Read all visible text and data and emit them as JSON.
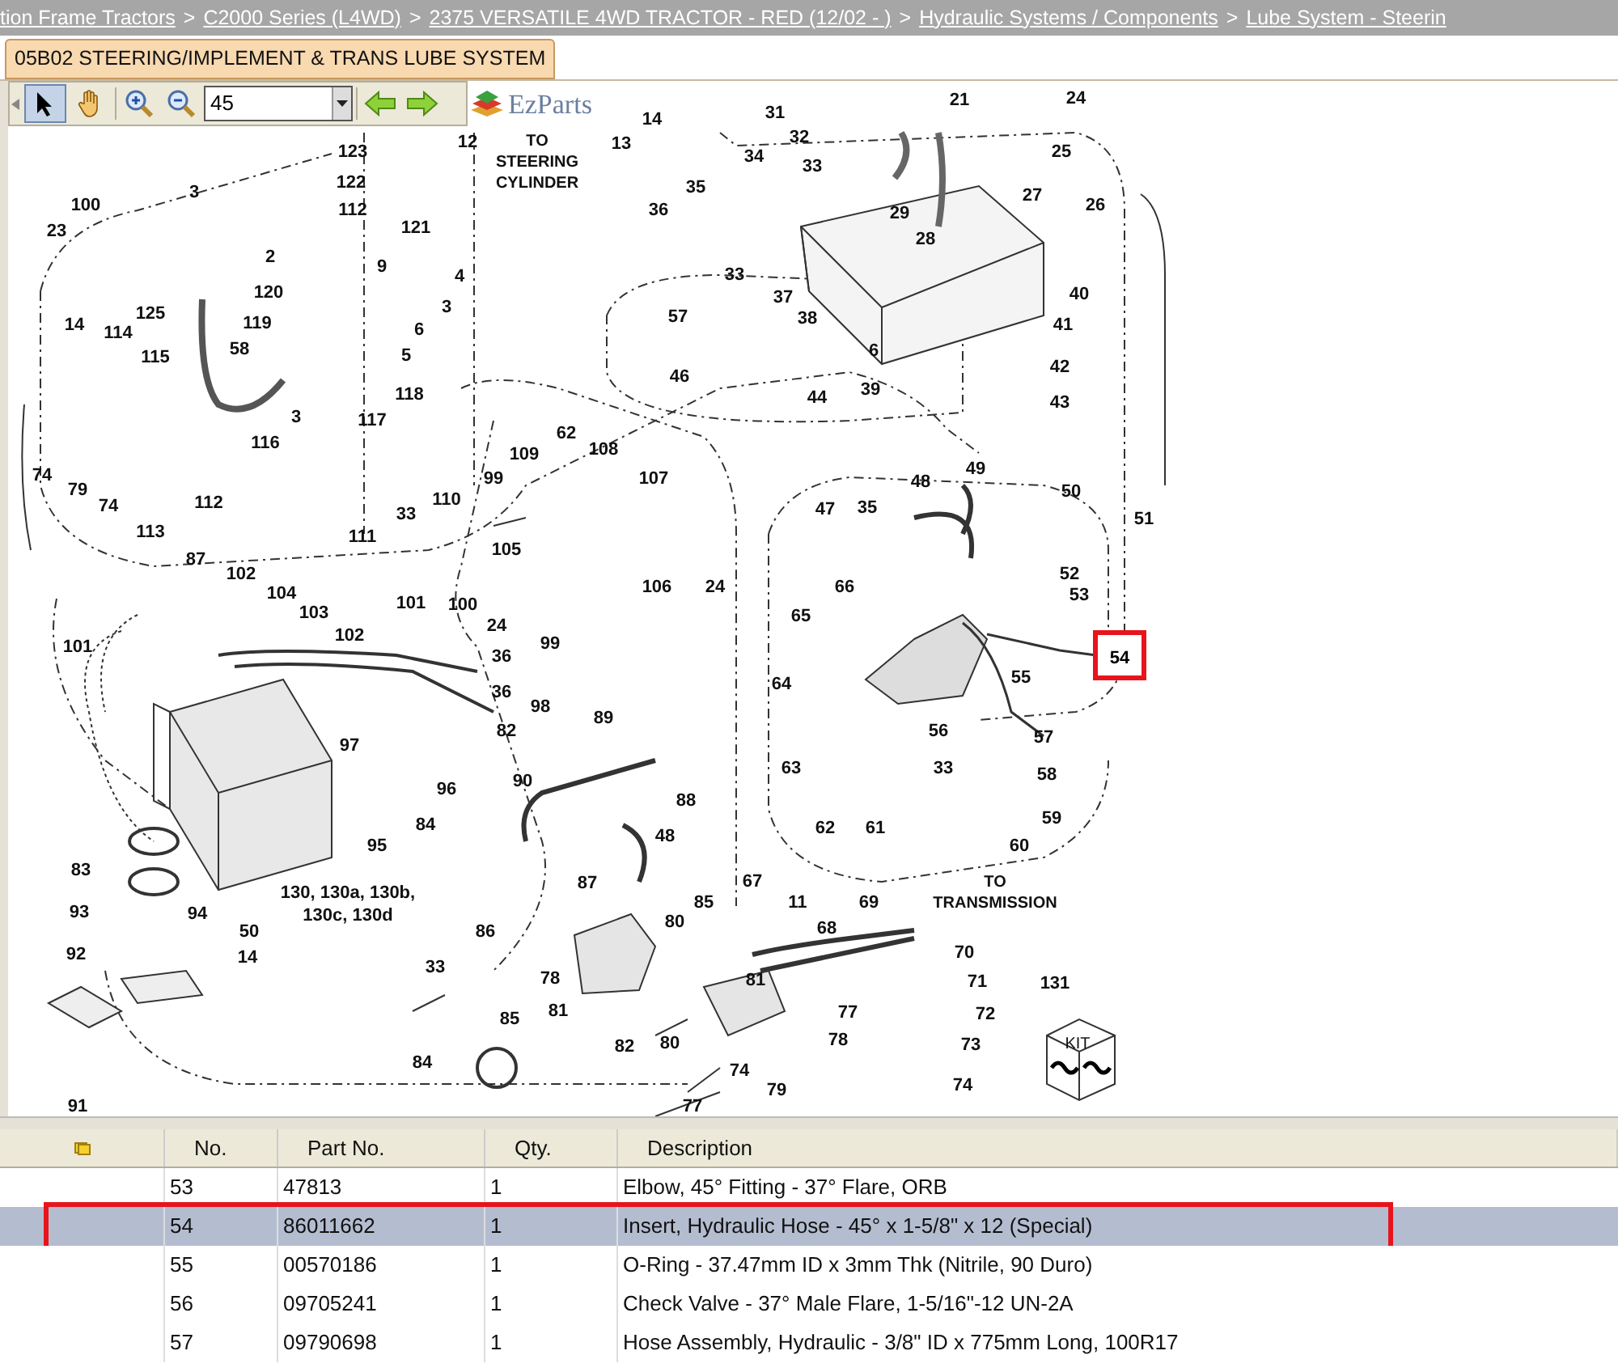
{
  "breadcrumb": [
    {
      "kind": "link",
      "text": "tion Frame Tractors"
    },
    {
      "kind": "separator",
      "text": ">"
    },
    {
      "kind": "link",
      "text": "C2000 Series (L4WD)"
    },
    {
      "kind": "separator",
      "text": ">"
    },
    {
      "kind": "link",
      "text": "2375 VERSATILE 4WD TRACTOR - RED (12/02 - )"
    },
    {
      "kind": "separator",
      "text": ">"
    },
    {
      "kind": "link",
      "text": "Hydraulic Systems / Components"
    },
    {
      "kind": "separator",
      "text": ">"
    },
    {
      "kind": "link",
      "text": "Lube System - Steerin"
    }
  ],
  "tabs": [
    {
      "label": "05B02 STEERING/IMPLEMENT & TRANS LUBE SYSTEM",
      "selected": true
    }
  ],
  "toolbar": {
    "tools": [
      {
        "kind": "pointer",
        "selected": true
      },
      {
        "kind": "hand",
        "selected": false
      }
    ],
    "zoom_value": "45",
    "logo": "EzParts"
  },
  "diagram": {
    "notes": [
      "TO STEERING CYLINDER",
      "TO TRANSMISSION"
    ],
    "kit_label": "KIT",
    "callouts": [
      {
        "label": "21",
        "selected": false
      },
      {
        "label": "24",
        "selected": false
      },
      {
        "label": "31",
        "selected": false
      },
      {
        "label": "14",
        "selected": false
      },
      {
        "label": "12",
        "selected": false
      },
      {
        "label": "13",
        "selected": false
      },
      {
        "label": "32",
        "selected": false
      },
      {
        "label": "123",
        "selected": false
      },
      {
        "label": "34",
        "selected": false
      },
      {
        "label": "25",
        "selected": false
      },
      {
        "label": "33",
        "selected": false
      },
      {
        "label": "3",
        "selected": false
      },
      {
        "label": "122",
        "selected": false
      },
      {
        "label": "35",
        "selected": false
      },
      {
        "label": "27",
        "selected": false
      },
      {
        "label": "100",
        "selected": false
      },
      {
        "label": "112",
        "selected": false
      },
      {
        "label": "36",
        "selected": false
      },
      {
        "label": "29",
        "selected": false
      },
      {
        "label": "26",
        "selected": false
      },
      {
        "label": "23",
        "selected": false
      },
      {
        "label": "121",
        "selected": false
      },
      {
        "label": "28",
        "selected": false
      },
      {
        "label": "2",
        "selected": false
      },
      {
        "label": "9",
        "selected": false
      },
      {
        "label": "4",
        "selected": false
      },
      {
        "label": "33",
        "selected": false
      },
      {
        "label": "120",
        "selected": false
      },
      {
        "label": "37",
        "selected": false
      },
      {
        "label": "40",
        "selected": false
      },
      {
        "label": "14",
        "selected": false
      },
      {
        "label": "114",
        "selected": false
      },
      {
        "label": "125",
        "selected": false
      },
      {
        "label": "119",
        "selected": false
      },
      {
        "label": "6",
        "selected": false
      },
      {
        "label": "3",
        "selected": false
      },
      {
        "label": "57",
        "selected": false
      },
      {
        "label": "38",
        "selected": false
      },
      {
        "label": "41",
        "selected": false
      },
      {
        "label": "115",
        "selected": false
      },
      {
        "label": "58",
        "selected": false
      },
      {
        "label": "5",
        "selected": false
      },
      {
        "label": "6",
        "selected": false
      },
      {
        "label": "42",
        "selected": false
      },
      {
        "label": "46",
        "selected": false
      },
      {
        "label": "118",
        "selected": false
      },
      {
        "label": "44",
        "selected": false
      },
      {
        "label": "39",
        "selected": false
      },
      {
        "label": "43",
        "selected": false
      },
      {
        "label": "3",
        "selected": false
      },
      {
        "label": "117",
        "selected": false
      },
      {
        "label": "62",
        "selected": false
      },
      {
        "label": "116",
        "selected": false
      },
      {
        "label": "109",
        "selected": false
      },
      {
        "label": "108",
        "selected": false
      },
      {
        "label": "74",
        "selected": false
      },
      {
        "label": "79",
        "selected": false
      },
      {
        "label": "99",
        "selected": false
      },
      {
        "label": "107",
        "selected": false
      },
      {
        "label": "48",
        "selected": false
      },
      {
        "label": "49",
        "selected": false
      },
      {
        "label": "50",
        "selected": false
      },
      {
        "label": "74",
        "selected": false
      },
      {
        "label": "112",
        "selected": false
      },
      {
        "label": "33",
        "selected": false
      },
      {
        "label": "110",
        "selected": false
      },
      {
        "label": "47",
        "selected": false
      },
      {
        "label": "35",
        "selected": false
      },
      {
        "label": "51",
        "selected": false
      },
      {
        "label": "113",
        "selected": false
      },
      {
        "label": "111",
        "selected": false
      },
      {
        "label": "105",
        "selected": false
      },
      {
        "label": "87",
        "selected": false
      },
      {
        "label": "102",
        "selected": false
      },
      {
        "label": "52",
        "selected": false
      },
      {
        "label": "104",
        "selected": false
      },
      {
        "label": "106",
        "selected": false
      },
      {
        "label": "24",
        "selected": false
      },
      {
        "label": "66",
        "selected": false
      },
      {
        "label": "53",
        "selected": false
      },
      {
        "label": "101",
        "selected": false
      },
      {
        "label": "100",
        "selected": false
      },
      {
        "label": "103",
        "selected": false
      },
      {
        "label": "65",
        "selected": false
      },
      {
        "label": "102",
        "selected": false
      },
      {
        "label": "24",
        "selected": false
      },
      {
        "label": "101",
        "selected": false
      },
      {
        "label": "99",
        "selected": false
      },
      {
        "label": "36",
        "selected": false
      },
      {
        "label": "54",
        "selected": true
      },
      {
        "label": "64",
        "selected": false
      },
      {
        "label": "55",
        "selected": false
      },
      {
        "label": "36",
        "selected": false
      },
      {
        "label": "98",
        "selected": false
      },
      {
        "label": "89",
        "selected": false
      },
      {
        "label": "82",
        "selected": false
      },
      {
        "label": "56",
        "selected": false
      },
      {
        "label": "57",
        "selected": false
      },
      {
        "label": "97",
        "selected": false
      },
      {
        "label": "96",
        "selected": false
      },
      {
        "label": "90",
        "selected": false
      },
      {
        "label": "63",
        "selected": false
      },
      {
        "label": "33",
        "selected": false
      },
      {
        "label": "58",
        "selected": false
      },
      {
        "label": "88",
        "selected": false
      },
      {
        "label": "84",
        "selected": false
      },
      {
        "label": "48",
        "selected": false
      },
      {
        "label": "62",
        "selected": false
      },
      {
        "label": "61",
        "selected": false
      },
      {
        "label": "59",
        "selected": false
      },
      {
        "label": "95",
        "selected": false
      },
      {
        "label": "60",
        "selected": false
      },
      {
        "label": "83",
        "selected": false
      },
      {
        "label": "87",
        "selected": false
      },
      {
        "label": "67",
        "selected": false
      },
      {
        "label": "130, 130a, 130b,",
        "selected": false
      },
      {
        "label": "85",
        "selected": false
      },
      {
        "label": "11",
        "selected": false
      },
      {
        "label": "69",
        "selected": false
      },
      {
        "label": "93",
        "selected": false
      },
      {
        "label": "94",
        "selected": false
      },
      {
        "label": "50",
        "selected": false
      },
      {
        "label": "130c, 130d",
        "selected": false
      },
      {
        "label": "86",
        "selected": false
      },
      {
        "label": "80",
        "selected": false
      },
      {
        "label": "68",
        "selected": false
      },
      {
        "label": "92",
        "selected": false
      },
      {
        "label": "14",
        "selected": false
      },
      {
        "label": "70",
        "selected": false
      },
      {
        "label": "33",
        "selected": false
      },
      {
        "label": "78",
        "selected": false
      },
      {
        "label": "81",
        "selected": false
      },
      {
        "label": "71",
        "selected": false
      },
      {
        "label": "131",
        "selected": false
      },
      {
        "label": "85",
        "selected": false
      },
      {
        "label": "81",
        "selected": false
      },
      {
        "label": "77",
        "selected": false
      },
      {
        "label": "72",
        "selected": false
      },
      {
        "label": "82",
        "selected": false
      },
      {
        "label": "80",
        "selected": false
      },
      {
        "label": "78",
        "selected": false
      },
      {
        "label": "73",
        "selected": false
      },
      {
        "label": "84",
        "selected": false
      },
      {
        "label": "74",
        "selected": false
      },
      {
        "label": "79",
        "selected": false
      },
      {
        "label": "74",
        "selected": false
      },
      {
        "label": "91",
        "selected": false
      },
      {
        "label": "77",
        "selected": false
      }
    ]
  },
  "table": {
    "columns": [
      "No.",
      "Part No.",
      "Qty.",
      "Description"
    ],
    "rows": [
      {
        "no": "53",
        "part_no": "47813",
        "qty": "1",
        "description": "Elbow, 45° Fitting - 37° Flare, ORB",
        "selected": false
      },
      {
        "no": "54",
        "part_no": "86011662",
        "qty": "1",
        "description": "Insert, Hydraulic Hose - 45° x 1-5/8\" x 12 (Special)",
        "selected": true
      },
      {
        "no": "55",
        "part_no": "00570186",
        "qty": "1",
        "description": "O-Ring - 37.47mm ID x 3mm Thk (Nitrile, 90 Duro)",
        "selected": false
      },
      {
        "no": "56",
        "part_no": "09705241",
        "qty": "1",
        "description": "Check Valve - 37° Male Flare, 1-5/16\"-12 UN-2A",
        "selected": false
      },
      {
        "no": "57",
        "part_no": "09790698",
        "qty": "1",
        "description": "Hose Assembly, Hydraulic - 3/8\" ID x 775mm Long, 100R17",
        "selected": false
      }
    ]
  }
}
